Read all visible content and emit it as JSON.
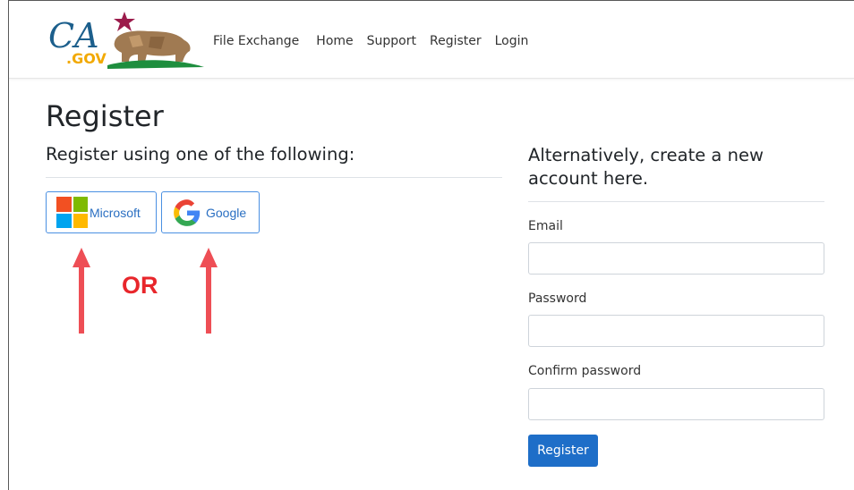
{
  "nav": {
    "brand": "File Exchange",
    "links": [
      "Home",
      "Support",
      "Register",
      "Login"
    ]
  },
  "logo": {
    "text": "CA.GOV"
  },
  "page": {
    "title": "Register",
    "external_heading": "Register using one of the following:",
    "providers": [
      {
        "label": "Microsoft",
        "icon": "microsoft-logo-icon"
      },
      {
        "label": "Google",
        "icon": "google-logo-icon"
      }
    ],
    "annotation": "OR",
    "local_heading": "Alternatively, create a new account here.",
    "fields": {
      "email_label": "Email",
      "email_value": "",
      "password_label": "Password",
      "password_value": "",
      "confirm_label": "Confirm password",
      "confirm_value": ""
    },
    "submit_label": "Register"
  },
  "colors": {
    "annotation_red": "#e8262b",
    "primary_button": "#1e6ec8",
    "provider_border": "#4a90e2"
  }
}
